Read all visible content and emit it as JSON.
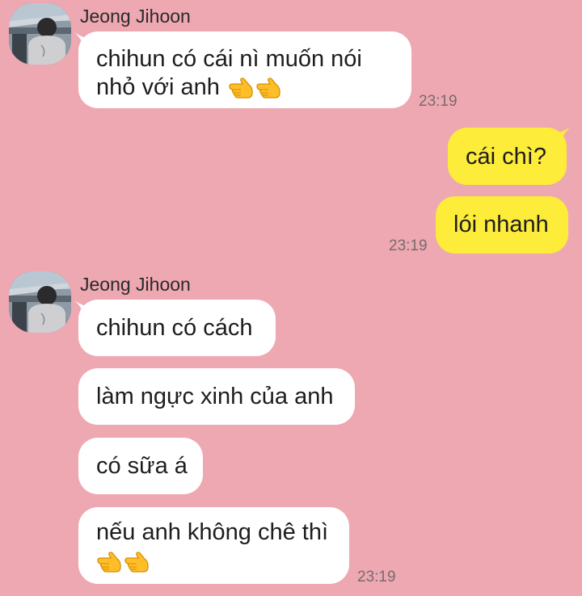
{
  "groups": [
    {
      "sender": "Jeong Jihoon",
      "avatar_icon": "profile-photo-avatar",
      "messages": [
        {
          "line1": "chihun có cái nì muốn nói",
          "line2": "nhỏ với anh",
          "emoji": "👉👉"
        }
      ],
      "time": "23:19"
    },
    {
      "sender": "Jeong Jihoon",
      "avatar_icon": "profile-photo-avatar",
      "messages": [
        {
          "text": "chihun có cách"
        },
        {
          "text": "làm ngực xinh của anh"
        },
        {
          "text": "có sữa á"
        },
        {
          "line1": "nếu anh không chê thì",
          "emoji": "👉👉"
        }
      ],
      "time": "23:19"
    }
  ],
  "outgoing": {
    "messages": [
      {
        "text": "cái chì?"
      },
      {
        "text": "lói nhanh"
      }
    ],
    "time": "23:19"
  },
  "colors": {
    "background": "#EDA8B1",
    "incoming_bubble": "#FFFFFF",
    "outgoing_bubble": "#FDEC3A",
    "timestamp": "#7A6A6E"
  }
}
